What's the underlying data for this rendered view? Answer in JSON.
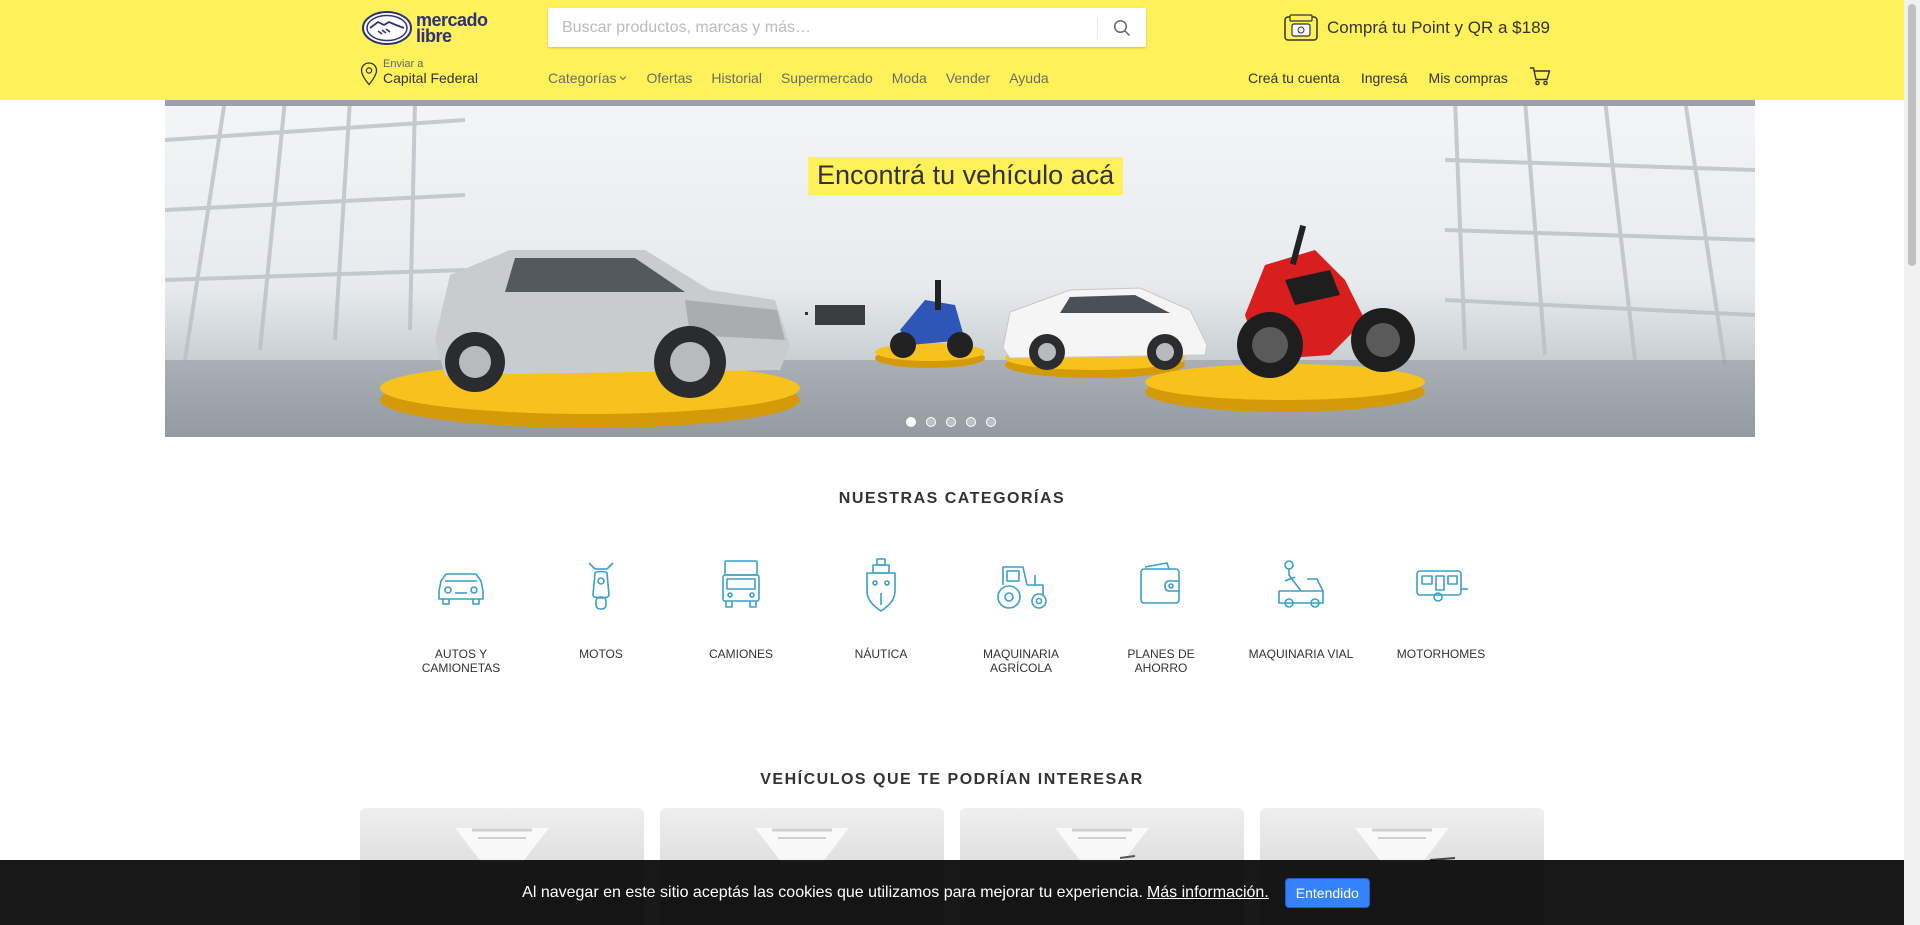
{
  "header": {
    "logo": {
      "line1": "mercado",
      "line2": "libre"
    },
    "search": {
      "placeholder": "Buscar productos, marcas y más…"
    },
    "promo": {
      "text": "Comprá tu Point y QR a $189"
    },
    "location": {
      "label": "Enviar a",
      "value": "Capital Federal"
    },
    "nav": [
      {
        "label": "Categorías"
      },
      {
        "label": "Ofertas"
      },
      {
        "label": "Historial"
      },
      {
        "label": "Supermercado"
      },
      {
        "label": "Moda"
      },
      {
        "label": "Vender"
      },
      {
        "label": "Ayuda"
      }
    ],
    "user_nav": [
      {
        "label": "Creá tu cuenta"
      },
      {
        "label": "Ingresá"
      },
      {
        "label": "Mis compras"
      }
    ]
  },
  "hero": {
    "title": "Encontrá tu vehículo acá",
    "slides_count": 5,
    "active_slide": 1
  },
  "categories": {
    "title": "NUESTRAS CATEGORÍAS",
    "items": [
      {
        "label": "AUTOS Y CAMIONETAS",
        "icon": "car-icon"
      },
      {
        "label": "MOTOS",
        "icon": "motorcycle-icon"
      },
      {
        "label": "CAMIONES",
        "icon": "truck-icon"
      },
      {
        "label": "NÁUTICA",
        "icon": "boat-icon"
      },
      {
        "label": "MAQUINARIA AGRÍCOLA",
        "icon": "tractor-icon"
      },
      {
        "label": "PLANES DE AHORRO",
        "icon": "wallet-icon"
      },
      {
        "label": "MAQUINARIA VIAL",
        "icon": "tow-truck-icon"
      },
      {
        "label": "MOTORHOMES",
        "icon": "motorhome-icon"
      }
    ]
  },
  "vehicles": {
    "title": "VEHÍCULOS QUE TE PODRÍAN INTERESAR",
    "card_count": 4
  },
  "cookie": {
    "text": "Al navegar en este sitio aceptás las cookies que utilizamos para mejorar tu experiencia.",
    "link": "Más información.",
    "button": "Entendido"
  },
  "colors": {
    "header_bg": "#fff159",
    "icon_accent": "#3aa0c8",
    "button_blue": "#3483fa"
  }
}
